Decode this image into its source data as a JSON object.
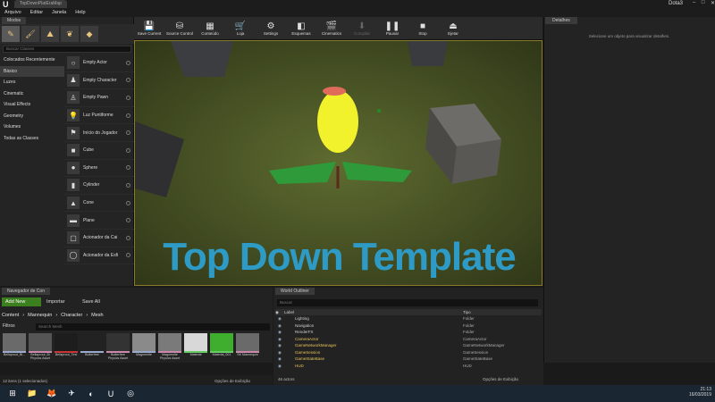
{
  "window": {
    "tab_title": "TopDownPlatEraMap",
    "project": "Dota3"
  },
  "menu": [
    "Arquivo",
    "Editar",
    "Janela",
    "Help"
  ],
  "modes": {
    "tab": "Modos",
    "search_placeholder": "Buscar Classes",
    "categories": [
      "Colocados Recentemente",
      "Básico",
      "Luzes",
      "Cinematic",
      "Visual Effects",
      "Geometry",
      "Volumes",
      "Todas as Classes"
    ],
    "actors": [
      "Empty Actor",
      "Empty Character",
      "Empty Pawn",
      "Luz Puntiforme",
      "Início do Jogador",
      "Cube",
      "Sphere",
      "Cylinder",
      "Cone",
      "Plane",
      "Acionador da Cai",
      "Acionador da Esfi"
    ]
  },
  "toolbar": [
    {
      "label": "Save Current",
      "icon": "💾"
    },
    {
      "label": "Source Control",
      "icon": "⛁"
    },
    {
      "label": "Conteúdo",
      "icon": "▦"
    },
    {
      "label": "Loja",
      "icon": "🛒"
    },
    {
      "label": "Settings",
      "icon": "⚙"
    },
    {
      "label": "Esquemas",
      "icon": "◧"
    },
    {
      "label": "Cinematics",
      "icon": "🎬"
    },
    {
      "label": "Compilar",
      "icon": "⬇"
    },
    {
      "label": "Pausar",
      "icon": "❚❚"
    },
    {
      "label": "Stop",
      "icon": "■"
    },
    {
      "label": "Ejetar",
      "icon": "⏏"
    }
  ],
  "viewport": {
    "overlay_text": "Top Down Template"
  },
  "details": {
    "tab": "Detalhes",
    "empty_message": "Selecione um objeto para visualizar detalhes."
  },
  "content_browser": {
    "tab": "Navegador de Con",
    "add_new": "Add New",
    "import": "Importar",
    "save_all": "Save All",
    "breadcrumb": [
      "Content",
      "Mannequin",
      "Character",
      "Mesh"
    ],
    "filters": "Filtros",
    "search_placeholder": "Search Mesh",
    "assets": [
      "Bellaprout_Bl...",
      "Bellaprout_Bl Physics Asset",
      "Bellsprout_Text",
      "Butterfree",
      "Butterfree Physics Asset",
      "Magnemite",
      "Magnemite Physics Asset",
      "Material",
      "Material_001",
      "SK Mannequin"
    ],
    "status": "12 itens (1 selecionados)",
    "view_options": "Opções de Exibição"
  },
  "world_outliner": {
    "tab": "World Outliner",
    "search_placeholder": "Buscar",
    "col_label": "Label",
    "col_type": "Tipo",
    "rows": [
      {
        "label": "Lighting",
        "type": "Folder"
      },
      {
        "label": "Navigation",
        "type": "Folder"
      },
      {
        "label": "RenderFX",
        "type": "Folder"
      },
      {
        "label": "CameraActor",
        "type": "CameraActor"
      },
      {
        "label": "GameNetworkManager",
        "type": "GameNetworkManager"
      },
      {
        "label": "GameSession",
        "type": "GameSession"
      },
      {
        "label": "GameStateBase",
        "type": "GameStateBase"
      },
      {
        "label": "HUD",
        "type": "HUD"
      }
    ],
    "count": "46 actors",
    "view_options": "Opções de Exibição"
  },
  "taskbar": {
    "time": "21:13",
    "date": "16/03/2019"
  }
}
